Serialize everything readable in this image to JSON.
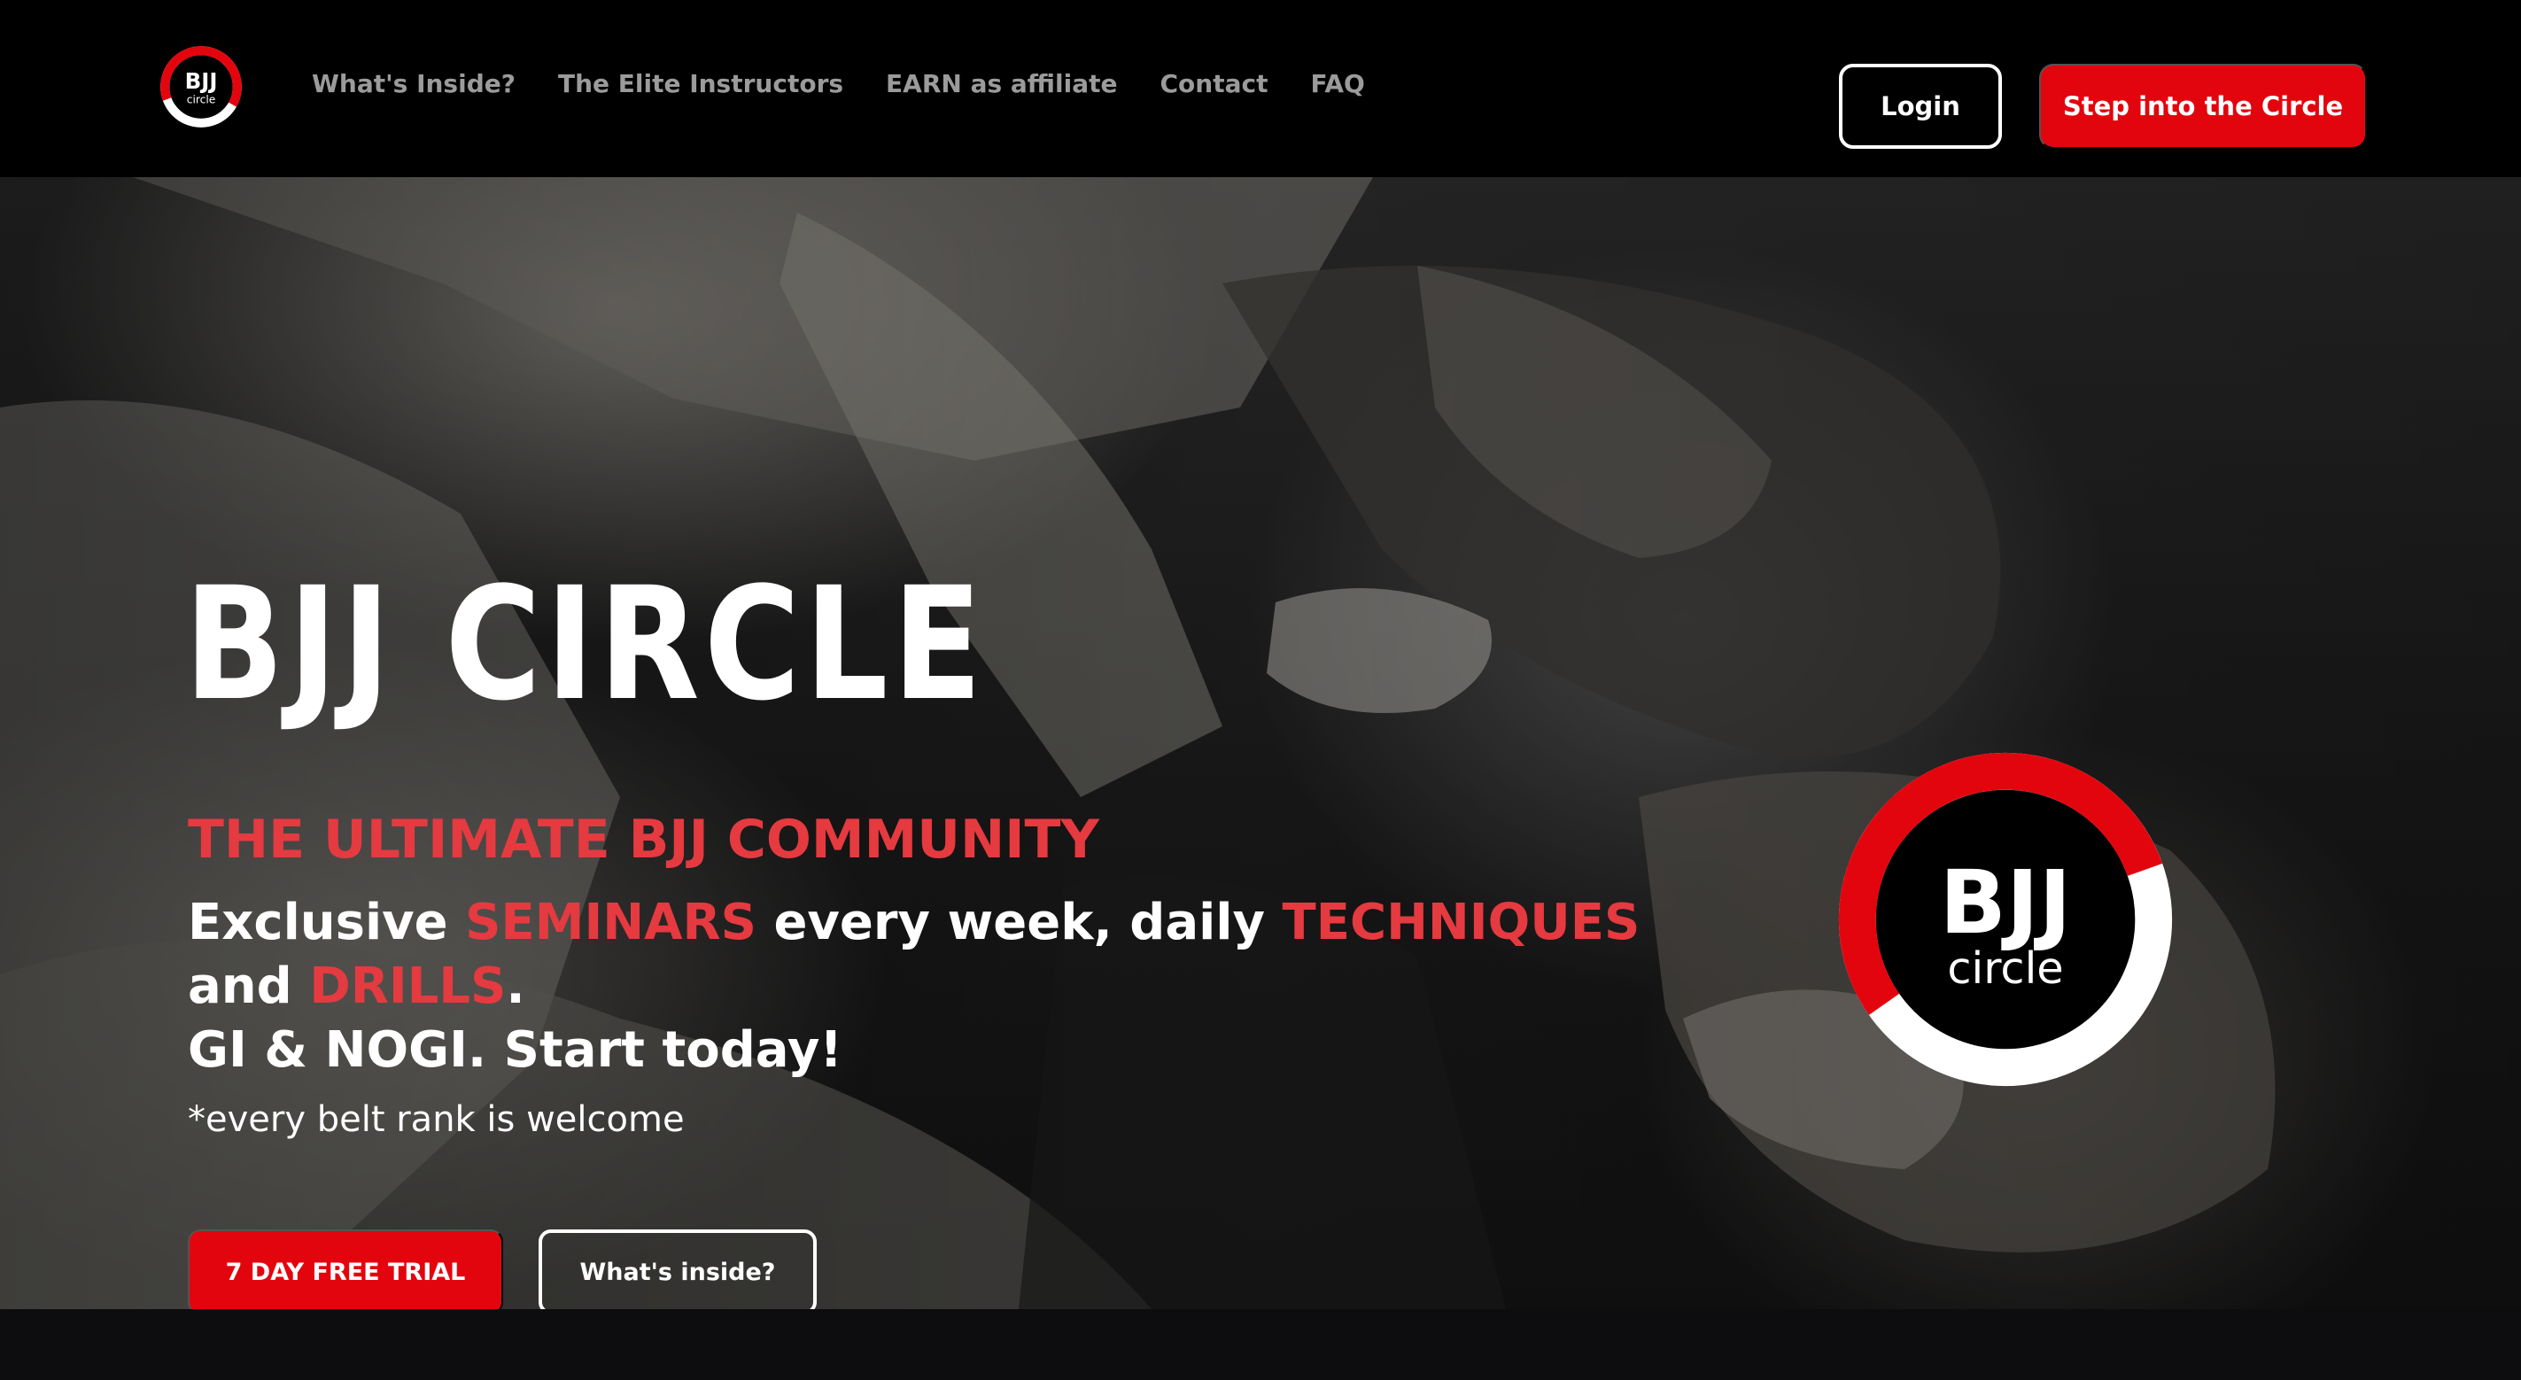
{
  "brand": {
    "logo_line1": "BJJ",
    "logo_line2": "circle",
    "accent_color": "#e3050e",
    "highlight_color": "#e53a40"
  },
  "nav": {
    "links": [
      "What's Inside?",
      "The Elite Instructors",
      "EARN as affiliate",
      "Contact",
      "FAQ"
    ],
    "login_label": "Login",
    "cta_label": "Step into the Circle"
  },
  "hero": {
    "title": "BJJ CIRCLE",
    "subtitle": "THE ULTIMATE BJJ COMMUNITY",
    "desc": {
      "t1": "Exclusive ",
      "h1": "SEMINARS",
      "t2": " every week, daily ",
      "h2": "TECHNIQUES",
      "t3": " and ",
      "h3": "DRILLS",
      "t4": ".",
      "line3": "GI & NOGI. Start today!"
    },
    "note": "*every belt rank is welcome",
    "primary_button": "7 DAY FREE TRIAL",
    "secondary_button": "What's inside?"
  }
}
